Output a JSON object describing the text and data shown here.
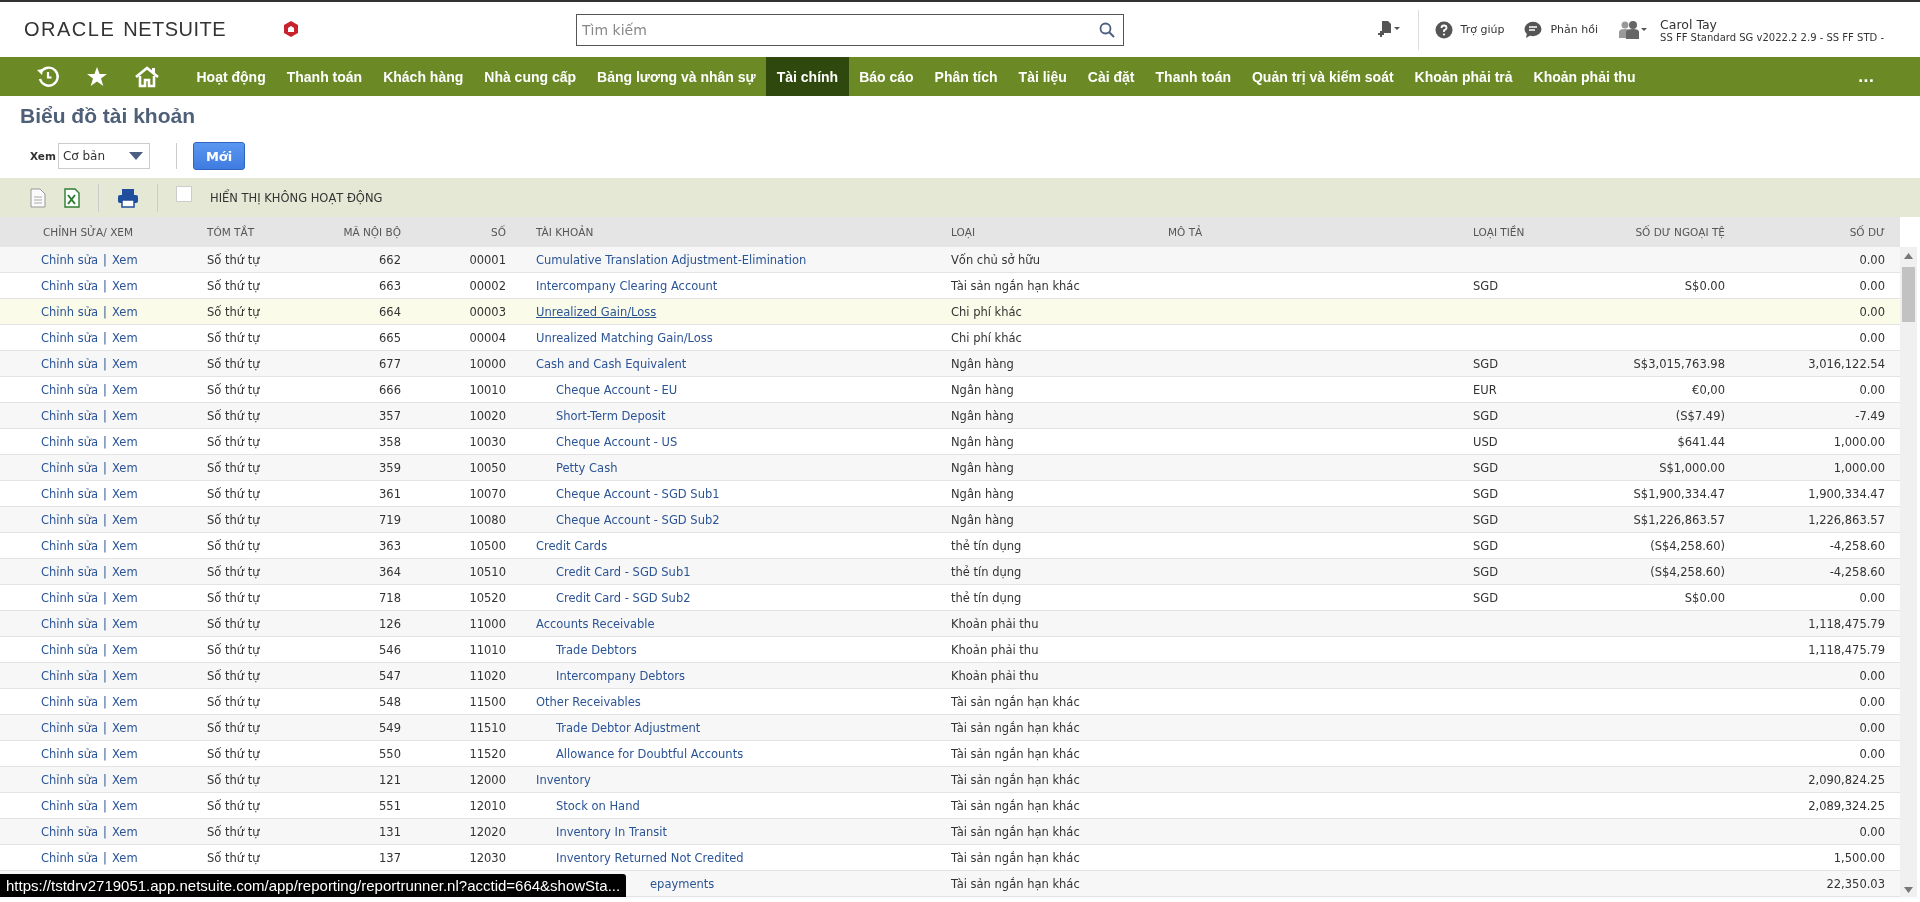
{
  "header": {
    "logo": {
      "brand": "ORACLE",
      "product": "NETSUITE"
    },
    "search": {
      "placeholder": "Tìm kiếm"
    },
    "help": "Trợ giúp",
    "feedback": "Phản hồi",
    "user": {
      "name": "Carol Tay",
      "role": "SS FF Standard SG v2022.2 2.9 - SS FF STD -"
    }
  },
  "nav": {
    "items": [
      {
        "label": "Hoạt động",
        "selected": false
      },
      {
        "label": "Thanh toán",
        "selected": false
      },
      {
        "label": "Khách hàng",
        "selected": false
      },
      {
        "label": "Nhà cung cấp",
        "selected": false
      },
      {
        "label": "Bảng lương và nhân sự",
        "selected": false
      },
      {
        "label": "Tài chính",
        "selected": true
      },
      {
        "label": "Báo cáo",
        "selected": false
      },
      {
        "label": "Phân tích",
        "selected": false
      },
      {
        "label": "Tài liệu",
        "selected": false
      },
      {
        "label": "Cài đặt",
        "selected": false
      },
      {
        "label": "Thanh toán",
        "selected": false
      },
      {
        "label": "Quản trị và kiểm soát",
        "selected": false
      },
      {
        "label": "Khoản phải trả",
        "selected": false
      },
      {
        "label": "Khoản phải thu",
        "selected": false
      }
    ],
    "more": "..."
  },
  "page": {
    "title": "Biểu đồ tài khoản",
    "view_label": "Xem",
    "view_value": "Cơ bản",
    "new_button": "Mới"
  },
  "toolbar": {
    "show_inactive": {
      "label": "HIỂN THỊ KHÔNG HOẠT ĐỘNG",
      "checked": false
    }
  },
  "table": {
    "columns": [
      "CHỈNH SỬA/ XEM",
      "TÓM TẮT",
      "MÃ NỘI BỘ",
      "SỐ",
      "TÀI KHOẢN",
      "LOẠI",
      "MÔ TẢ",
      "LOẠI TIỀN",
      "SỐ DƯ NGOẠI TỆ",
      "SỐ DƯ"
    ],
    "rows": [
      {
        "kind": "account",
        "edit": "Chỉnh sửa",
        "sep": "|",
        "view": "Xem",
        "summary": "Số thứ tự",
        "internal_id": "662",
        "number": "00001",
        "account": "Cumulative Translation Adjustment-Elimination",
        "type": "Vốn chủ sở hữu",
        "balance": "0.00",
        "highlighted": false
      },
      {
        "kind": "account",
        "edit": "Chỉnh sửa",
        "sep": "|",
        "view": "Xem",
        "summary": "Số thứ tự",
        "internal_id": "663",
        "number": "00002",
        "account": "Intercompany Clearing Account",
        "type": "Tài sản ngắn hạn khác",
        "currency": "SGD",
        "foreign_balance": "S$0.00",
        "balance": "0.00",
        "highlighted": false
      },
      {
        "kind": "account",
        "edit": "Chỉnh sửa",
        "sep": "|",
        "view": "Xem",
        "summary": "Số thứ tự",
        "internal_id": "664",
        "number": "00003",
        "account": "Unrealized Gain/Loss",
        "type": "Chi phí khác",
        "balance": "0.00",
        "highlighted": true
      },
      {
        "kind": "account",
        "edit": "Chỉnh sửa",
        "sep": "|",
        "view": "Xem",
        "summary": "Số thứ tự",
        "internal_id": "665",
        "number": "00004",
        "account": "Unrealized Matching Gain/Loss",
        "type": "Chi phí khác",
        "balance": "0.00",
        "highlighted": false
      },
      {
        "kind": "account",
        "edit": "Chỉnh sửa",
        "sep": "|",
        "view": "Xem",
        "summary": "Số thứ tự",
        "internal_id": "677",
        "number": "10000",
        "account": "Cash and Cash Equivalent",
        "type": "Ngân hàng",
        "currency": "SGD",
        "foreign_balance": "S$3,015,763.98",
        "balance": "3,016,122.54",
        "highlighted": false,
        "children": [
          {
            "kind": "account",
            "edit": "Chỉnh sửa",
            "sep": "|",
            "view": "Xem",
            "summary": "Số thứ tự",
            "internal_id": "666",
            "number": "10010",
            "account": "Cheque Account - EU",
            "type": "Ngân hàng",
            "currency": "EUR",
            "foreign_balance": "€0,00",
            "balance": "0.00",
            "highlighted": false
          },
          {
            "kind": "account",
            "edit": "Chỉnh sửa",
            "sep": "|",
            "view": "Xem",
            "summary": "Số thứ tự",
            "internal_id": "357",
            "number": "10020",
            "account": "Short-Term Deposit",
            "type": "Ngân hàng",
            "currency": "SGD",
            "foreign_balance": "(S$7.49)",
            "balance": "-7.49",
            "highlighted": false
          },
          {
            "kind": "account",
            "edit": "Chỉnh sửa",
            "sep": "|",
            "view": "Xem",
            "summary": "Số thứ tự",
            "internal_id": "358",
            "number": "10030",
            "account": "Cheque Account - US",
            "type": "Ngân hàng",
            "currency": "USD",
            "foreign_balance": "$641.44",
            "balance": "1,000.00",
            "highlighted": false
          },
          {
            "kind": "account",
            "edit": "Chỉnh sửa",
            "sep": "|",
            "view": "Xem",
            "summary": "Số thứ tự",
            "internal_id": "359",
            "number": "10050",
            "account": "Petty Cash",
            "type": "Ngân hàng",
            "currency": "SGD",
            "foreign_balance": "S$1,000.00",
            "balance": "1,000.00",
            "highlighted": false
          },
          {
            "kind": "account",
            "edit": "Chỉnh sửa",
            "sep": "|",
            "view": "Xem",
            "summary": "Số thứ tự",
            "internal_id": "361",
            "number": "10070",
            "account": "Cheque Account - SGD Sub1",
            "type": "Ngân hàng",
            "currency": "SGD",
            "foreign_balance": "S$1,900,334.47",
            "balance": "1,900,334.47",
            "highlighted": false
          },
          {
            "kind": "account",
            "edit": "Chỉnh sửa",
            "sep": "|",
            "view": "Xem",
            "summary": "Số thứ tự",
            "internal_id": "719",
            "number": "10080",
            "account": "Cheque Account - SGD Sub2",
            "type": "Ngân hàng",
            "currency": "SGD",
            "foreign_balance": "S$1,226,863.57",
            "balance": "1,226,863.57",
            "highlighted": false
          }
        ]
      },
      {
        "kind": "account",
        "edit": "Chỉnh sửa",
        "sep": "|",
        "view": "Xem",
        "summary": "Số thứ tự",
        "internal_id": "363",
        "number": "10500",
        "account": "Credit Cards",
        "type": "thẻ tín dụng",
        "currency": "SGD",
        "foreign_balance": "(S$4,258.60)",
        "balance": "-4,258.60",
        "highlighted": false,
        "children": [
          {
            "kind": "account",
            "edit": "Chỉnh sửa",
            "sep": "|",
            "view": "Xem",
            "summary": "Số thứ tự",
            "internal_id": "364",
            "number": "10510",
            "account": "Credit Card - SGD Sub1",
            "type": "thẻ tín dụng",
            "currency": "SGD",
            "foreign_balance": "(S$4,258.60)",
            "balance": "-4,258.60",
            "highlighted": false
          },
          {
            "kind": "account",
            "edit": "Chỉnh sửa",
            "sep": "|",
            "view": "Xem",
            "summary": "Số thứ tự",
            "internal_id": "718",
            "number": "10520",
            "account": "Credit Card - SGD Sub2",
            "type": "thẻ tín dụng",
            "currency": "SGD",
            "foreign_balance": "S$0.00",
            "balance": "0.00",
            "highlighted": false
          }
        ]
      },
      {
        "kind": "account",
        "edit": "Chỉnh sửa",
        "sep": "|",
        "view": "Xem",
        "summary": "Số thứ tự",
        "internal_id": "126",
        "number": "11000",
        "account": "Accounts Receivable",
        "type": "Khoản phải thu",
        "balance": "1,118,475.79",
        "highlighted": false,
        "children": [
          {
            "kind": "account",
            "edit": "Chỉnh sửa",
            "sep": "|",
            "view": "Xem",
            "summary": "Số thứ tự",
            "internal_id": "546",
            "number": "11010",
            "account": "Trade Debtors",
            "type": "Khoản phải thu",
            "balance": "1,118,475.79",
            "highlighted": false
          },
          {
            "kind": "account",
            "edit": "Chỉnh sửa",
            "sep": "|",
            "view": "Xem",
            "summary": "Số thứ tự",
            "internal_id": "547",
            "number": "11020",
            "account": "Intercompany Debtors",
            "type": "Khoản phải thu",
            "balance": "0.00",
            "highlighted": false
          }
        ]
      },
      {
        "kind": "account",
        "edit": "Chỉnh sửa",
        "sep": "|",
        "view": "Xem",
        "summary": "Số thứ tự",
        "internal_id": "548",
        "number": "11500",
        "account": "Other Receivables",
        "type": "Tài sản ngắn hạn khác",
        "balance": "0.00",
        "highlighted": false,
        "children": [
          {
            "kind": "account",
            "edit": "Chỉnh sửa",
            "sep": "|",
            "view": "Xem",
            "summary": "Số thứ tự",
            "internal_id": "549",
            "number": "11510",
            "account": "Trade Debtor Adjustment",
            "type": "Tài sản ngắn hạn khác",
            "balance": "0.00",
            "highlighted": false
          },
          {
            "kind": "account",
            "edit": "Chỉnh sửa",
            "sep": "|",
            "view": "Xem",
            "summary": "Số thứ tự",
            "internal_id": "550",
            "number": "11520",
            "account": "Allowance for Doubtful Accounts",
            "type": "Tài sản ngắn hạn khác",
            "balance": "0.00",
            "highlighted": false
          }
        ]
      },
      {
        "kind": "account",
        "edit": "Chỉnh sửa",
        "sep": "|",
        "view": "Xem",
        "summary": "Số thứ tự",
        "internal_id": "121",
        "number": "12000",
        "account": "Inventory",
        "type": "Tài sản ngắn hạn khác",
        "balance": "2,090,824.25",
        "highlighted": false,
        "children": [
          {
            "kind": "account",
            "edit": "Chỉnh sửa",
            "sep": "|",
            "view": "Xem",
            "summary": "Số thứ tự",
            "internal_id": "551",
            "number": "12010",
            "account": "Stock on Hand",
            "type": "Tài sản ngắn hạn khác",
            "balance": "2,089,324.25",
            "highlighted": false
          },
          {
            "kind": "account",
            "edit": "Chỉnh sửa",
            "sep": "|",
            "view": "Xem",
            "summary": "Số thứ tự",
            "internal_id": "131",
            "number": "12020",
            "account": "Inventory In Transit",
            "type": "Tài sản ngắn hạn khác",
            "balance": "0.00",
            "highlighted": false
          },
          {
            "kind": "account",
            "edit": "Chỉnh sửa",
            "sep": "|",
            "view": "Xem",
            "summary": "Số thứ tự",
            "internal_id": "137",
            "number": "12030",
            "account": "Inventory Returned Not Credited",
            "type": "Tài sản ngắn hạn khác",
            "balance": "1,500.00",
            "highlighted": false
          },
          {
            "kind": "covered",
            "account": "epayments",
            "type": "Tài sản ngắn hạn khác",
            "balance": "22,350.03",
            "highlighted": false
          }
        ]
      }
    ]
  },
  "status_url": "https://tstdrv2719051.app.netsuite.com/app/reporting/reportrunner.nl?acctid=664&showSta..."
}
